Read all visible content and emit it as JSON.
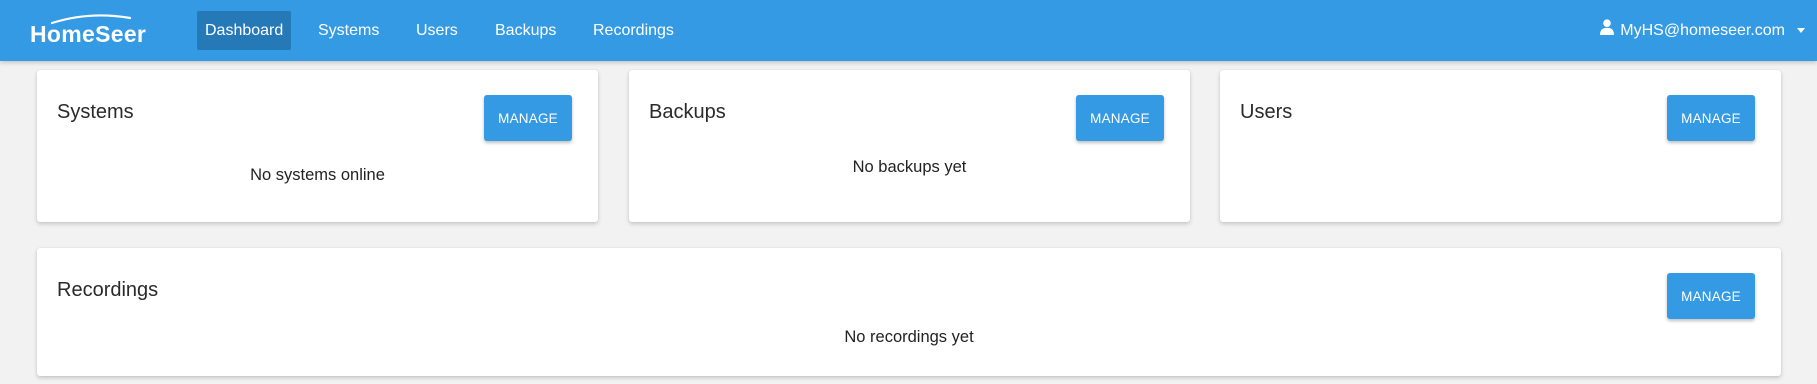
{
  "app": {
    "brand": "HomeSeer",
    "colors": {
      "primary": "#359ae4",
      "active_nav": "#2579b7",
      "background": "#f2f2f2"
    }
  },
  "nav": {
    "items": [
      {
        "label": "Dashboard",
        "active": true
      },
      {
        "label": "Systems",
        "active": false
      },
      {
        "label": "Users",
        "active": false
      },
      {
        "label": "Backups",
        "active": false
      },
      {
        "label": "Recordings",
        "active": false
      }
    ],
    "user": {
      "icon": "user-icon",
      "label": "MyHS@homeseer.com",
      "menu_icon": "caret-down-icon"
    }
  },
  "cards": {
    "systems": {
      "title": "Systems",
      "button": "MANAGE",
      "message": "No systems online"
    },
    "backups": {
      "title": "Backups",
      "button": "MANAGE",
      "message": "No backups yet"
    },
    "users": {
      "title": "Users",
      "button": "MANAGE",
      "message": ""
    },
    "recordings": {
      "title": "Recordings",
      "button": "MANAGE",
      "message": "No recordings yet"
    }
  }
}
